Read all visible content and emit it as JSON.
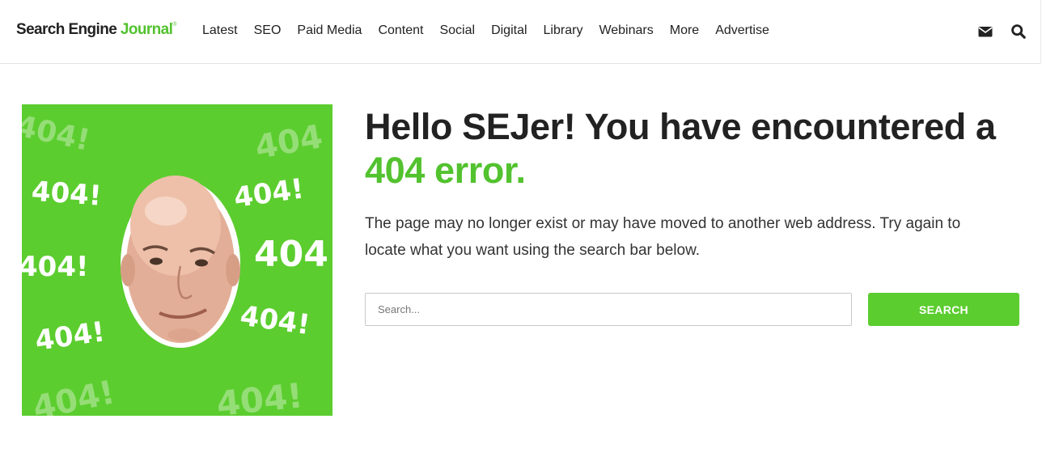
{
  "header": {
    "logo": {
      "part1": "Search Engine",
      "part2": "Journal",
      "mark": "®"
    },
    "nav": [
      {
        "label": "Latest"
      },
      {
        "label": "SEO"
      },
      {
        "label": "Paid Media"
      },
      {
        "label": "Content"
      },
      {
        "label": "Social"
      },
      {
        "label": "Digital"
      },
      {
        "label": "Library"
      },
      {
        "label": "Webinars"
      },
      {
        "label": "More"
      },
      {
        "label": "Advertise"
      }
    ],
    "icons": {
      "mail": "envelope-icon",
      "search": "search-icon"
    }
  },
  "hero": {
    "image_text": [
      "404!",
      "404!",
      "404!",
      "404",
      "404!",
      "404!",
      "404!",
      "404!",
      "404!",
      "404"
    ],
    "title_main": "Hello SEJer! You have encountered a",
    "title_accent": "404 error.",
    "description": "The page may no longer exist or may have moved to another web address. Try again to locate what you want using the search bar below."
  },
  "search": {
    "placeholder": "Search...",
    "value": "",
    "button_label": "SEARCH"
  },
  "colors": {
    "brand_green": "#52c22e",
    "button_green": "#5ccd2f",
    "text_dark": "#222222"
  }
}
